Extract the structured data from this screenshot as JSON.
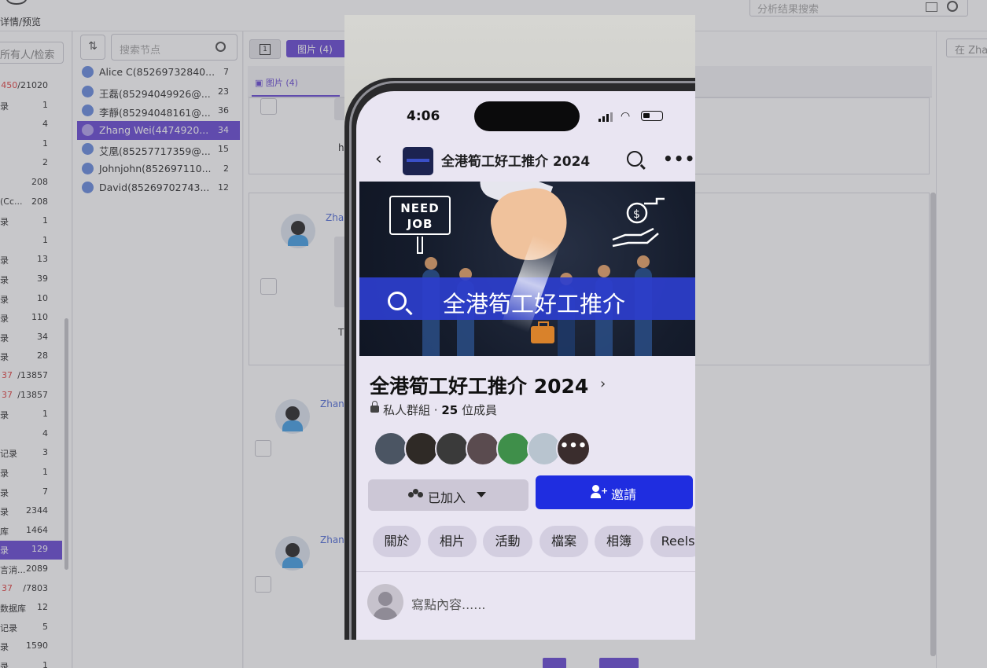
{
  "app": {
    "title": "详情/预览"
  },
  "top_search": {
    "placeholder": "分析结果搜索"
  },
  "left_panel": {
    "filter": "所有人/检索",
    "rows": [
      {
        "label": "",
        "count": "450/21020",
        "red": true
      },
      {
        "label": "录",
        "count": "1"
      },
      {
        "label": "",
        "count": "4"
      },
      {
        "label": "",
        "count": "1"
      },
      {
        "label": "",
        "count": "2"
      },
      {
        "label": "",
        "count": "208"
      },
      {
        "label": "(Cc...",
        "count": "208"
      },
      {
        "label": "录",
        "count": "1"
      },
      {
        "label": "",
        "count": "1"
      },
      {
        "label": "录",
        "count": "13"
      },
      {
        "label": "录",
        "count": "39"
      },
      {
        "label": "录",
        "count": "10"
      },
      {
        "label": "录",
        "count": "110"
      },
      {
        "label": "录",
        "count": "34"
      },
      {
        "label": "录",
        "count": "28"
      },
      {
        "label": "37",
        "count": "/13857",
        "red_label": true
      },
      {
        "label": "37",
        "count": "/13857",
        "red_label": true
      },
      {
        "label": "录",
        "count": "1"
      },
      {
        "label": "",
        "count": "4"
      },
      {
        "label": "记录",
        "count": "3"
      },
      {
        "label": "录",
        "count": "1"
      },
      {
        "label": "录",
        "count": "7"
      },
      {
        "label": "录",
        "count": "2344"
      },
      {
        "label": "库",
        "count": "1464"
      },
      {
        "label": "录",
        "count": "129",
        "active": true
      },
      {
        "label": "言消...",
        "count": "2089"
      },
      {
        "label": "37",
        "count": "/7803",
        "red_label": true
      },
      {
        "label": "数据库",
        "count": "12"
      },
      {
        "label": "记录",
        "count": "5"
      },
      {
        "label": "录",
        "count": "1590"
      },
      {
        "label": "录",
        "count": "1"
      }
    ]
  },
  "node_panel": {
    "sort_icon": "sort-icon",
    "search_placeholder": "搜索节点",
    "contacts": [
      {
        "name": "Alice C(85269732840...",
        "count": "7"
      },
      {
        "name": "王磊(85294049926@...",
        "count": "23"
      },
      {
        "name": "李靜(85294048161@...",
        "count": "36"
      },
      {
        "name": "Zhang Wei(4474920...",
        "count": "34",
        "active": true
      },
      {
        "name": "艾凰(85257717359@...",
        "count": "15"
      },
      {
        "name": "Johnjohn(852697110...",
        "count": "2"
      },
      {
        "name": "David(85269702743...",
        "count": "12"
      }
    ]
  },
  "main": {
    "tab_num": "1",
    "tab_pill": "图片 (4)",
    "subtab": "图片 (4)",
    "messages": [
      {
        "name": "Zhang",
        "preview_fragment_1": "h",
        "preview_fragment_2": "T"
      },
      {
        "name": "Zhang"
      },
      {
        "name": "Zhang"
      }
    ]
  },
  "right_panel": {
    "placeholder": "在 Zha"
  },
  "preview": {
    "status": {
      "time": "4:06"
    },
    "nav": {
      "title": "全港筍工好工推介 2024",
      "back_icon": "chevron-left-icon",
      "search_icon": "search-icon",
      "more_icon": "more-horizontal-icon"
    },
    "cover": {
      "sign_text": "NEED\nJOB",
      "banner_text": "全港筍工好工推介"
    },
    "group": {
      "name": "全港筍工好工推介 2024",
      "privacy": "私人群組",
      "separator": "·",
      "member_count": "25",
      "member_label": "位成員"
    },
    "member_avatars": [
      {
        "color": "#4b5563"
      },
      {
        "color": "#2f2a26"
      },
      {
        "color": "#3a3a3a"
      },
      {
        "color": "#5a4b4f"
      },
      {
        "color": "#3f8f4a"
      },
      {
        "color": "#b8c4cf"
      }
    ],
    "more_members": "•••",
    "actions": {
      "joined": "已加入",
      "invite": "邀請"
    },
    "chips": [
      "關於",
      "相片",
      "活動",
      "檔案",
      "相簿",
      "Reels"
    ],
    "composer": {
      "placeholder": "寫點內容......"
    }
  }
}
